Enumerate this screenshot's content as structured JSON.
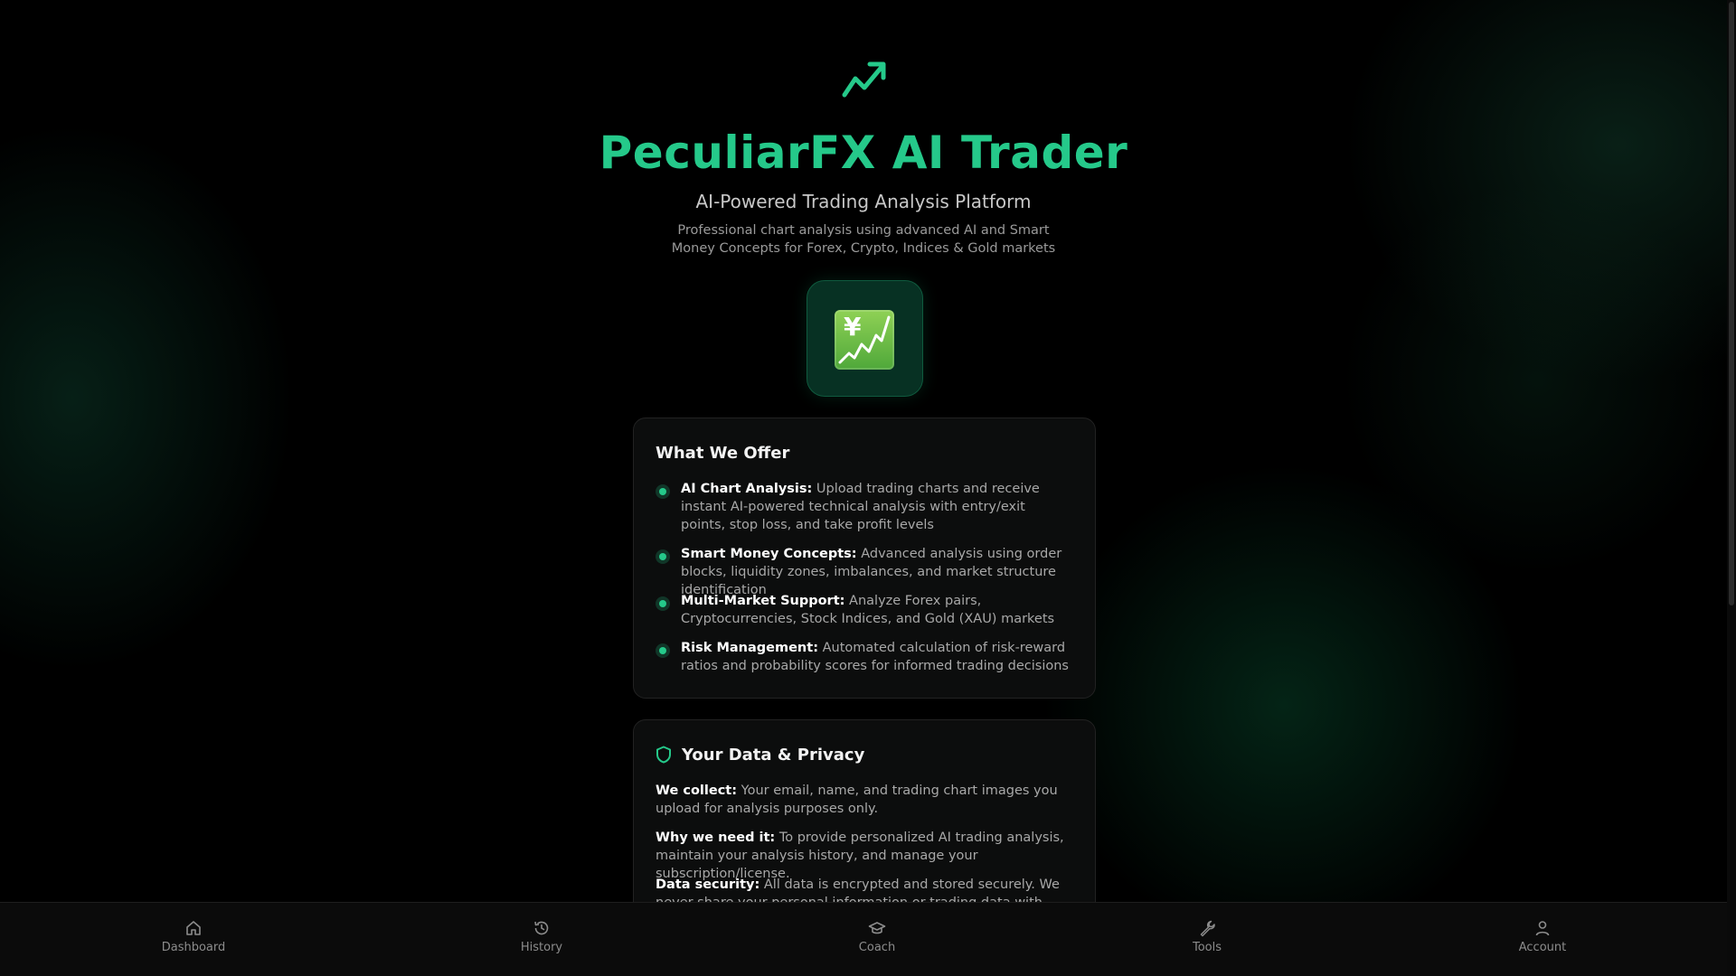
{
  "hero": {
    "icon": "trending-up-icon",
    "title": "PeculiarFX AI Trader",
    "subtitle": "AI-Powered Trading Analysis Platform",
    "description": "Professional chart analysis using advanced AI and Smart Money Concepts for Forex, Crypto, Indices & Gold markets",
    "logo": {
      "icon": "chart-increasing-with-yen-icon",
      "glyph": "¥"
    },
    "accent_color": "#25c98a"
  },
  "offer": {
    "title": "What We Offer",
    "items": [
      {
        "label": "AI Chart Analysis:",
        "text": " Upload trading charts and receive instant AI-powered technical analysis with entry/exit points, stop loss, and take profit levels"
      },
      {
        "label": "Smart Money Concepts:",
        "text": " Advanced analysis using order blocks, liquidity zones, imbalances, and market structure identification"
      },
      {
        "label": "Multi-Market Support:",
        "text": " Analyze Forex pairs, Cryptocurrencies, Stock Indices, and Gold (XAU) markets"
      },
      {
        "label": "Risk Management:",
        "text": " Automated calculation of risk-reward ratios and probability scores for informed trading decisions"
      }
    ]
  },
  "privacy": {
    "icon": "shield-icon",
    "title": "Your Data & Privacy",
    "items": [
      {
        "label": "We collect:",
        "text": " Your email, name, and trading chart images you upload for analysis purposes only."
      },
      {
        "label": "Why we need it:",
        "text": " To provide personalized AI trading analysis, maintain your analysis history, and manage your subscription/license."
      },
      {
        "label": "Data security:",
        "text": " All data is encrypted and stored securely. We never share your personal information or trading data with third parties."
      }
    ]
  },
  "nav": {
    "items": [
      {
        "label": "Dashboard",
        "icon": "home-icon"
      },
      {
        "label": "History",
        "icon": "history-icon"
      },
      {
        "label": "Coach",
        "icon": "graduation-cap-icon"
      },
      {
        "label": "Tools",
        "icon": "wrench-icon"
      },
      {
        "label": "Account",
        "icon": "user-icon"
      }
    ]
  }
}
